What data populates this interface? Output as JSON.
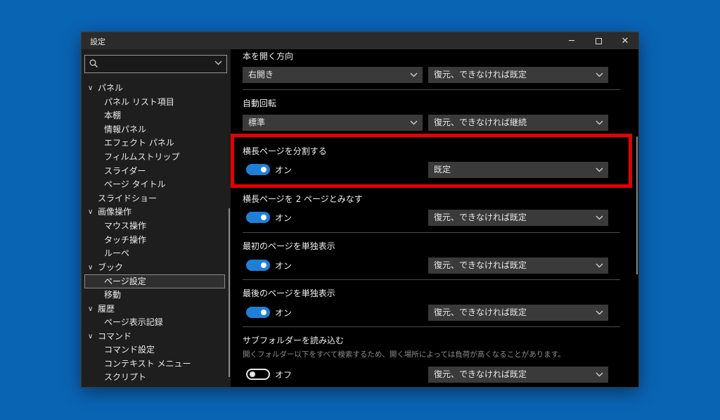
{
  "window": {
    "title": "設定",
    "controls": {
      "minimize": "─",
      "close": "✕"
    }
  },
  "sidebar": {
    "search": {
      "value": "",
      "placeholder": ""
    },
    "items": [
      {
        "label": "パネル",
        "expander": "∨"
      },
      {
        "label": "パネル リスト項目"
      },
      {
        "label": "本棚"
      },
      {
        "label": "情報パネル"
      },
      {
        "label": "エフェクト パネル"
      },
      {
        "label": "フィルムストリップ"
      },
      {
        "label": "スライダー"
      },
      {
        "label": "ページ タイトル"
      },
      {
        "label": "スライドショー"
      },
      {
        "label": "画像操作",
        "expander": "∨"
      },
      {
        "label": "マウス操作"
      },
      {
        "label": "タッチ操作"
      },
      {
        "label": "ルーペ"
      },
      {
        "label": "ブック",
        "expander": "∨"
      },
      {
        "label": "ページ設定"
      },
      {
        "label": "移動"
      },
      {
        "label": "履歴",
        "expander": "∨"
      },
      {
        "label": "ページ表示記録"
      },
      {
        "label": "コマンド",
        "expander": "∨"
      },
      {
        "label": "コマンド設定"
      },
      {
        "label": "コンテキスト メニュー"
      },
      {
        "label": "スクリプト"
      }
    ]
  },
  "settings": [
    {
      "title": "本を開く方向",
      "left_value": "右開き",
      "right_value": "復元、できなければ既定"
    },
    {
      "title": "自動回転",
      "left_value": "標準",
      "right_value": "復元、できなければ継続"
    },
    {
      "title": "横長ページを分割する",
      "toggle_label": "オン",
      "toggle_on": true,
      "right_value": "既定"
    },
    {
      "title": "横長ページを 2 ページとみなす",
      "toggle_label": "オン",
      "toggle_on": true,
      "right_value": "復元、できなければ既定"
    },
    {
      "title": "最初のページを単独表示",
      "toggle_label": "オン",
      "toggle_on": true,
      "right_value": "復元、できなければ既定"
    },
    {
      "title": "最後のページを単独表示",
      "toggle_label": "オン",
      "toggle_on": true,
      "right_value": "復元、できなければ既定"
    },
    {
      "title": "サブフォルダーを読み込む",
      "description": "開くフォルダー以下をすべて検索するため、開く場所によっては負荷が高くなることがあります。",
      "toggle_label": "オフ",
      "toggle_on": false,
      "right_value": "復元、できなければ既定"
    }
  ],
  "colors": {
    "desktop": "#0a64b4",
    "toggle_on": "#1e7fd8",
    "highlight": "#e60000"
  },
  "icons": {
    "search": "search-icon",
    "dropdown": "chevron-down-icon",
    "maximize": "maximize-icon"
  }
}
